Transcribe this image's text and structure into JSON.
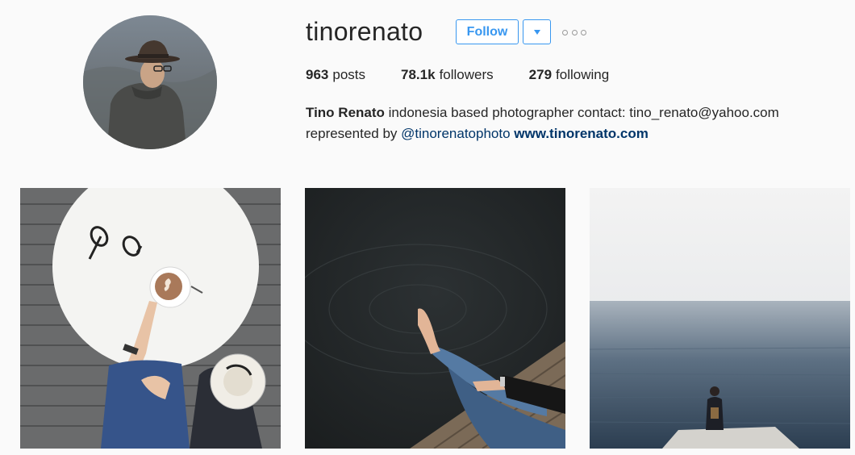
{
  "profile": {
    "username": "tinorenato",
    "follow_label": "Follow",
    "stats": {
      "posts_count": "963",
      "posts_label": "posts",
      "followers_count": "78.1k",
      "followers_label": "followers",
      "following_count": "279",
      "following_label": "following"
    },
    "bio": {
      "full_name": "Tino Renato",
      "text_line1": " indonesia based photographer contact: tino_renato@yahoo.com",
      "text_line2_prefix": "represented by ",
      "mention": "@tinorenatophoto",
      "website": "www.tinorenato.com"
    }
  },
  "posts": [
    {
      "name": "coffee-table-photo"
    },
    {
      "name": "legs-over-water-photo"
    },
    {
      "name": "misty-sea-photo"
    }
  ],
  "icons": {
    "dropdown": "chevron-down-icon",
    "more": "more-options-icon"
  },
  "colors": {
    "accent": "#3897f0",
    "link": "#003569",
    "background": "#fafafa",
    "text": "#262626"
  }
}
